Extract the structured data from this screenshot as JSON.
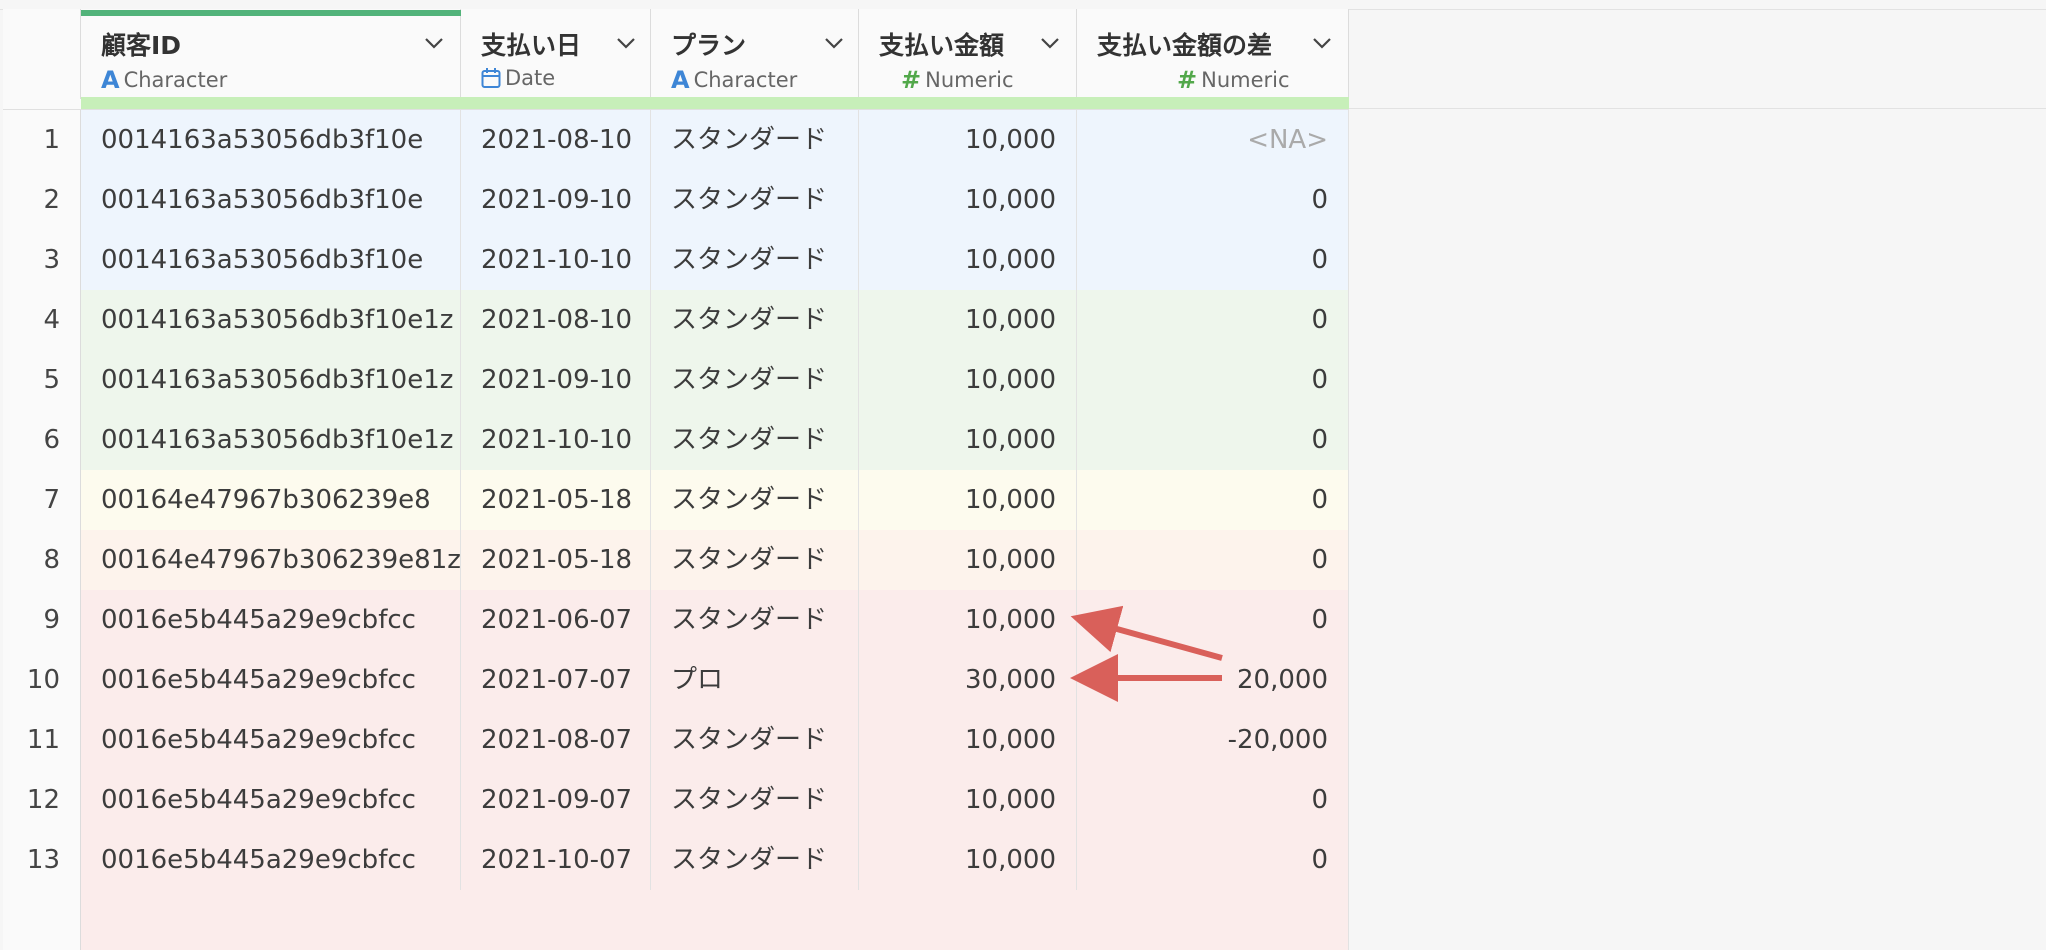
{
  "columns": [
    {
      "name": "顧客ID",
      "type": "Character"
    },
    {
      "name": "支払い日",
      "type": "Date"
    },
    {
      "name": "プラン",
      "type": "Character"
    },
    {
      "name": "支払い金額",
      "type": "Numeric"
    },
    {
      "name": "支払い金額の差",
      "type": "Numeric"
    }
  ],
  "rows": [
    {
      "num": "1",
      "id": "0014163a53056db3f10e",
      "date": "2021-08-10",
      "plan": "スタンダード",
      "amount": "10,000",
      "diff": "<NA>"
    },
    {
      "num": "2",
      "id": "0014163a53056db3f10e",
      "date": "2021-09-10",
      "plan": "スタンダード",
      "amount": "10,000",
      "diff": "0"
    },
    {
      "num": "3",
      "id": "0014163a53056db3f10e",
      "date": "2021-10-10",
      "plan": "スタンダード",
      "amount": "10,000",
      "diff": "0"
    },
    {
      "num": "4",
      "id": "0014163a53056db3f10e1z",
      "date": "2021-08-10",
      "plan": "スタンダード",
      "amount": "10,000",
      "diff": "0"
    },
    {
      "num": "5",
      "id": "0014163a53056db3f10e1z",
      "date": "2021-09-10",
      "plan": "スタンダード",
      "amount": "10,000",
      "diff": "0"
    },
    {
      "num": "6",
      "id": "0014163a53056db3f10e1z",
      "date": "2021-10-10",
      "plan": "スタンダード",
      "amount": "10,000",
      "diff": "0"
    },
    {
      "num": "7",
      "id": "00164e47967b306239e8",
      "date": "2021-05-18",
      "plan": "スタンダード",
      "amount": "10,000",
      "diff": "0"
    },
    {
      "num": "8",
      "id": "00164e47967b306239e81z",
      "date": "2021-05-18",
      "plan": "スタンダード",
      "amount": "10,000",
      "diff": "0"
    },
    {
      "num": "9",
      "id": "0016e5b445a29e9cbfcc",
      "date": "2021-06-07",
      "plan": "スタンダード",
      "amount": "10,000",
      "diff": "0"
    },
    {
      "num": "10",
      "id": "0016e5b445a29e9cbfcc",
      "date": "2021-07-07",
      "plan": "プロ",
      "amount": "30,000",
      "diff": "20,000"
    },
    {
      "num": "11",
      "id": "0016e5b445a29e9cbfcc",
      "date": "2021-08-07",
      "plan": "スタンダード",
      "amount": "10,000",
      "diff": "-20,000"
    },
    {
      "num": "12",
      "id": "0016e5b445a29e9cbfcc",
      "date": "2021-09-07",
      "plan": "スタンダード",
      "amount": "10,000",
      "diff": "0"
    },
    {
      "num": "13",
      "id": "0016e5b445a29e9cbfcc",
      "date": "2021-10-07",
      "plan": "スタンダード",
      "amount": "10,000",
      "diff": "0"
    }
  ],
  "colors": {
    "group_blue": "#eef5fd",
    "group_green": "#eef6ec",
    "group_yellow": "#fdfbee",
    "group_peach": "#fdf3ec",
    "group_pink": "#fbeceb",
    "arrow": "#d9605a",
    "header_accent": "#52b37a",
    "header_band": "#c7efb9"
  }
}
